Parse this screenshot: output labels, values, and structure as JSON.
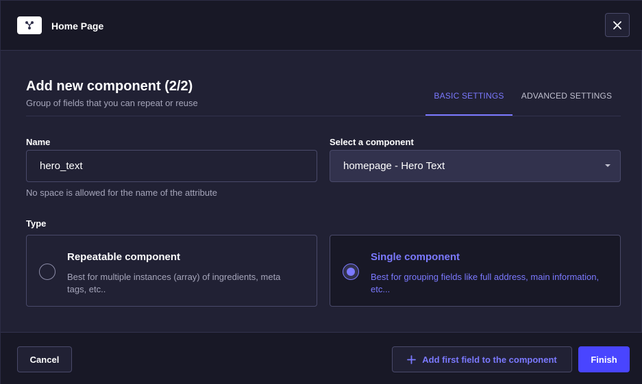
{
  "header": {
    "app_icon": "component-share-icon",
    "title": "Home Page",
    "close_icon": "close-icon"
  },
  "main": {
    "title": "Add new component (2/2)",
    "subtitle": "Group of fields that you can repeat or reuse",
    "tabs": [
      {
        "label": "BASIC SETTINGS",
        "active": true
      },
      {
        "label": "ADVANCED SETTINGS",
        "active": false
      }
    ],
    "name_field": {
      "label": "Name",
      "value": "hero_text",
      "hint": "No space is allowed for the name of the attribute"
    },
    "select_field": {
      "label": "Select a component",
      "value": "homepage - Hero Text"
    },
    "type": {
      "label": "Type",
      "options": [
        {
          "title": "Repeatable component",
          "description": "Best for multiple instances (array) of ingredients, meta tags, etc..",
          "selected": false
        },
        {
          "title": "Single component",
          "description": "Best for grouping fields like full address, main information, etc...",
          "selected": true
        }
      ]
    }
  },
  "footer": {
    "cancel_label": "Cancel",
    "add_field_label": "Add first field to the component",
    "finish_label": "Finish"
  },
  "colors": {
    "accent": "#7b79ff",
    "primary_button": "#4945ff",
    "background": "#212134",
    "header_footer": "#181826"
  }
}
